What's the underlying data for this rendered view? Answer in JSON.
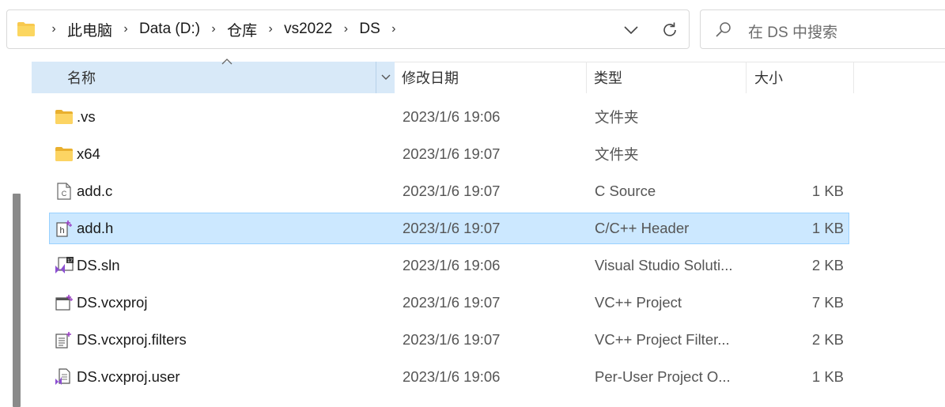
{
  "breadcrumb": [
    "此电脑",
    "Data (D:)",
    "仓库",
    "vs2022",
    "DS"
  ],
  "search": {
    "placeholder": "在 DS 中搜索"
  },
  "columns": {
    "name": "名称",
    "date": "修改日期",
    "type": "类型",
    "size": "大小"
  },
  "files": [
    {
      "name": ".vs",
      "date": "2023/1/6 19:06",
      "type": "文件夹",
      "size": "",
      "icon": "folder-icon"
    },
    {
      "name": "x64",
      "date": "2023/1/6 19:07",
      "type": "文件夹",
      "size": "",
      "icon": "folder-icon"
    },
    {
      "name": "add.c",
      "date": "2023/1/6 19:07",
      "type": "C Source",
      "size": "1 KB",
      "icon": "c-source-icon"
    },
    {
      "name": "add.h",
      "date": "2023/1/6 19:07",
      "type": "C/C++ Header",
      "size": "1 KB",
      "icon": "header-file-icon"
    },
    {
      "name": "DS.sln",
      "date": "2023/1/6 19:06",
      "type": "Visual Studio Soluti...",
      "size": "2 KB",
      "icon": "vs-solution-icon"
    },
    {
      "name": "DS.vcxproj",
      "date": "2023/1/6 19:07",
      "type": "VC++ Project",
      "size": "7 KB",
      "icon": "vcxproj-icon"
    },
    {
      "name": "DS.vcxproj.filters",
      "date": "2023/1/6 19:07",
      "type": "VC++ Project Filter...",
      "size": "2 KB",
      "icon": "filters-file-icon"
    },
    {
      "name": "DS.vcxproj.user",
      "date": "2023/1/6 19:06",
      "type": "Per-User Project O...",
      "size": "1 KB",
      "icon": "user-file-icon"
    }
  ],
  "selected_file": "add.h",
  "colors": {
    "selection_bg": "#cce8ff",
    "selection_border": "#99d1ff",
    "header_bg": "#d8e9f8",
    "folder": "#f8c94f"
  }
}
